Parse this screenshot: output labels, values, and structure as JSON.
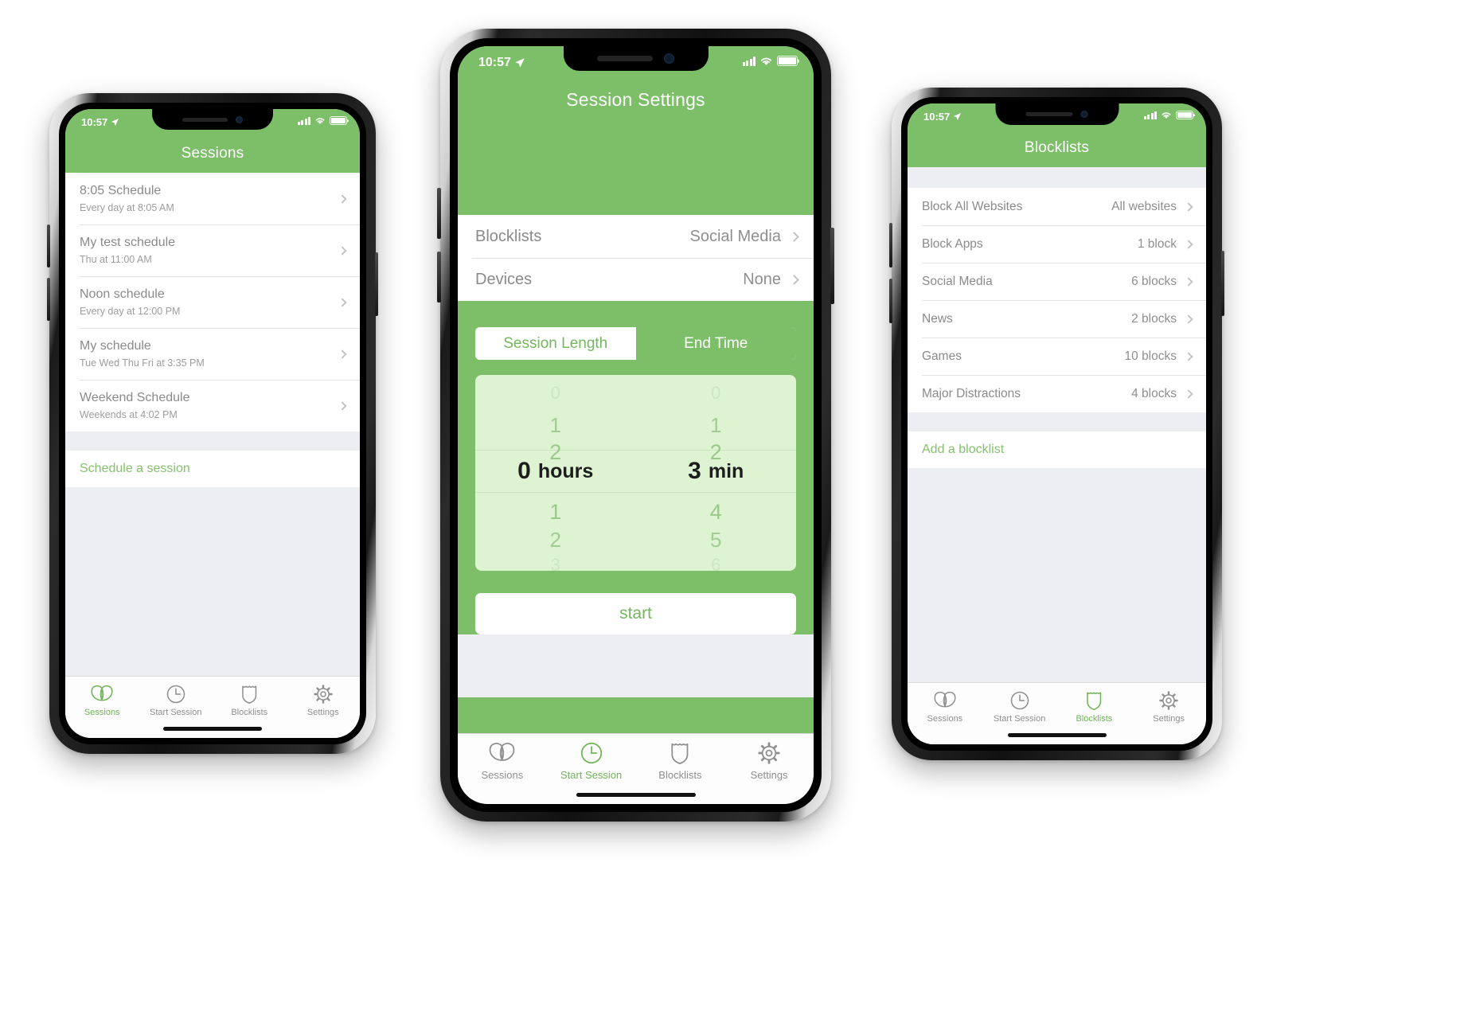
{
  "app": {
    "accent_green": "#7cbf68",
    "accent_green_text": "#74b75e",
    "list_bg": "#eceef2"
  },
  "phone_left": {
    "status": {
      "time": "10:57",
      "location_icon": "location-arrow-icon"
    },
    "navbar": {
      "title": "Sessions"
    },
    "sessions": [
      {
        "title": "8:05 Schedule",
        "subtitle": "Every day at 8:05 AM"
      },
      {
        "title": "My test schedule",
        "subtitle": "Thu at 11:00 AM"
      },
      {
        "title": "Noon schedule",
        "subtitle": "Every day at 12:00 PM"
      },
      {
        "title": "My schedule",
        "subtitle": "Tue Wed Thu Fri at 3:35 PM"
      },
      {
        "title": "Weekend Schedule",
        "subtitle": "Weekends at 4:02 PM"
      }
    ],
    "add_link": "Schedule a session",
    "tabs": [
      {
        "label": "Sessions",
        "icon": "butterfly-icon",
        "active": true
      },
      {
        "label": "Start Session",
        "icon": "clock-icon",
        "active": false
      },
      {
        "label": "Blocklists",
        "icon": "shield-icon",
        "active": false
      },
      {
        "label": "Settings",
        "icon": "gear-icon",
        "active": false
      }
    ]
  },
  "phone_center": {
    "status": {
      "time": "10:57",
      "location_icon": "location-arrow-icon"
    },
    "navbar": {
      "title": "Session Settings"
    },
    "settings_rows": [
      {
        "label": "Blocklists",
        "value": "Social Media"
      },
      {
        "label": "Devices",
        "value": "None"
      }
    ],
    "segmented": {
      "options": [
        "Session Length",
        "End Time"
      ],
      "selected": "End Time"
    },
    "picker": {
      "hours": {
        "above": [
          "0",
          "1",
          "2"
        ],
        "selected": "0",
        "unit": "hours",
        "below": [
          "1",
          "2",
          "3"
        ]
      },
      "minutes": {
        "above": [
          "0",
          "1",
          "2"
        ],
        "selected": "3",
        "unit": "min",
        "below": [
          "4",
          "5",
          "6"
        ]
      }
    },
    "start_button": "start",
    "tabs": [
      {
        "label": "Sessions",
        "icon": "butterfly-icon",
        "active": false
      },
      {
        "label": "Start Session",
        "icon": "clock-icon",
        "active": true
      },
      {
        "label": "Blocklists",
        "icon": "shield-icon",
        "active": false
      },
      {
        "label": "Settings",
        "icon": "gear-icon",
        "active": false
      }
    ]
  },
  "phone_right": {
    "status": {
      "time": "10:57",
      "location_icon": "location-arrow-icon"
    },
    "navbar": {
      "title": "Blocklists"
    },
    "blocklists": [
      {
        "label": "Block All Websites",
        "value": "All websites"
      },
      {
        "label": "Block Apps",
        "value": "1 block"
      },
      {
        "label": "Social Media",
        "value": "6 blocks"
      },
      {
        "label": "News",
        "value": "2 blocks"
      },
      {
        "label": "Games",
        "value": "10 blocks"
      },
      {
        "label": "Major Distractions",
        "value": "4 blocks"
      }
    ],
    "add_link": "Add a blocklist",
    "tabs": [
      {
        "label": "Sessions",
        "icon": "butterfly-icon",
        "active": false
      },
      {
        "label": "Start Session",
        "icon": "clock-icon",
        "active": false
      },
      {
        "label": "Blocklists",
        "icon": "shield-icon",
        "active": true
      },
      {
        "label": "Settings",
        "icon": "gear-icon",
        "active": false
      }
    ]
  }
}
